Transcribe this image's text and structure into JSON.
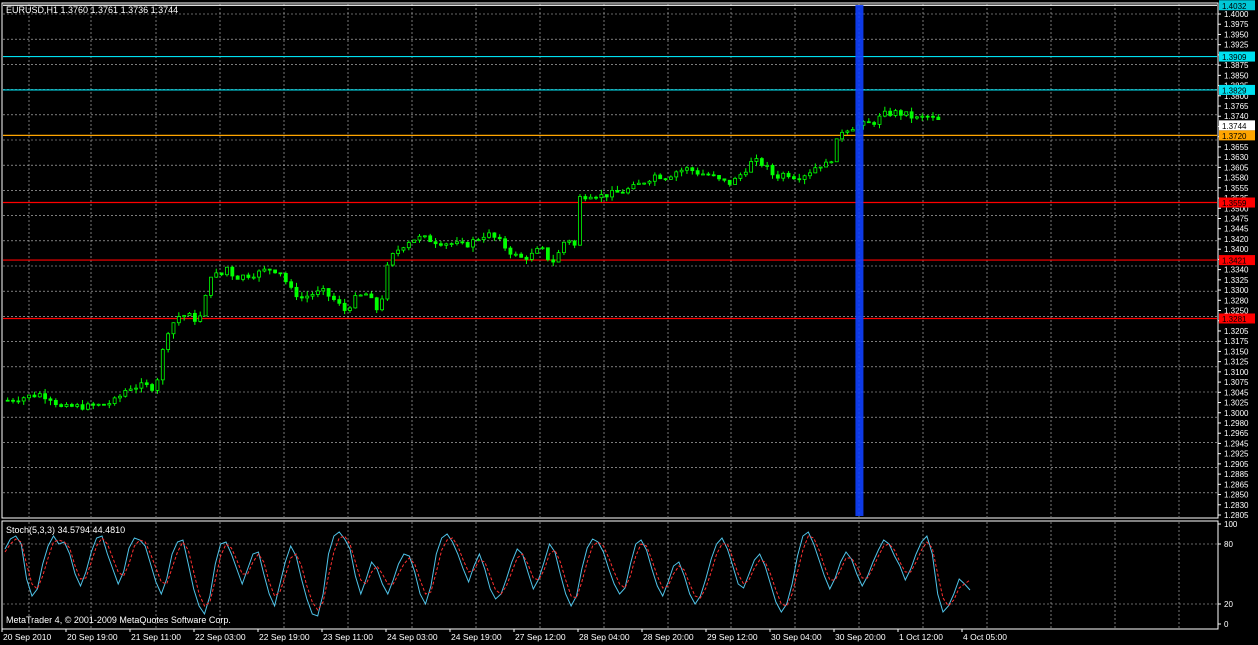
{
  "window": {
    "symbol_info": "EURUSD,H1  1.3760 1.3761 1.3736 1.3744",
    "indicator_info": "Stoch(5,3,3) 34.5794 44.4810",
    "copyright": "MetaTrader 4, © 2001-2009 MetaQuotes Software Corp."
  },
  "colors": {
    "background": "#000000",
    "grid": "#c8c8c8",
    "candle": "#00ff00",
    "axis_text": "#ffffff",
    "stoch_main": "#4fc3e8",
    "stoch_signal": "#ff3030",
    "vline": "#1040ff",
    "border": "#ffffff"
  },
  "chart_data": [
    {
      "type": "candlestick",
      "symbol": "EURUSD",
      "timeframe": "H1",
      "ylim": [
        1.2805,
        1.4035
      ],
      "price_ticks": [
        "1.4000",
        "1.3975",
        "1.3950",
        "1.3925",
        "1.3900",
        "1.3875",
        "1.3850",
        "1.3825",
        "1.3800",
        "1.3765",
        "1.3740",
        "1.3715",
        "1.3685",
        "1.3655",
        "1.3630",
        "1.3605",
        "1.3580",
        "1.3555",
        "1.3535",
        "1.3500",
        "1.3475",
        "1.3445",
        "1.3420",
        "1.3400",
        "1.3365",
        "1.3340",
        "1.3325",
        "1.3300",
        "1.3280",
        "1.3250",
        "1.3225",
        "1.3205",
        "1.3175",
        "1.3150",
        "1.3125",
        "1.3100",
        "1.3075",
        "1.3045",
        "1.3025",
        "1.3000",
        "1.2980",
        "1.2965",
        "1.2945",
        "1.2925",
        "1.2905",
        "1.2885",
        "1.2865",
        "1.2850",
        "1.2830",
        "1.2805"
      ],
      "time_labels": [
        "20 Sep 2010",
        "20 Sep 19:00",
        "21 Sep 11:00",
        "22 Sep 03:00",
        "22 Sep 19:00",
        "23 Sep 11:00",
        "24 Sep 03:00",
        "24 Sep 19:00",
        "27 Sep 12:00",
        "28 Sep 04:00",
        "28 Sep 20:00",
        "29 Sep 12:00",
        "30 Sep 04:00",
        "30 Sep 20:00",
        "1 Oct 12:00",
        "4 Oct 05:00"
      ],
      "horizontal_lines": [
        {
          "price": 1.4032,
          "label": "1.4032",
          "color": "#ffffff",
          "tag_bg": "#00c8d8",
          "tag_fg": "#000000"
        },
        {
          "price": 1.3909,
          "label": "1.3909",
          "color": "#00e0f0",
          "tag_bg": "#00e0f0",
          "tag_fg": "#000000"
        },
        {
          "price": 1.3829,
          "label": "1.3829",
          "color": "#00e0f0",
          "tag_bg": "#00e0f0",
          "tag_fg": "#000000"
        },
        {
          "price": 1.3744,
          "label": "1.3744",
          "color": null,
          "tag_bg": "#ffffff",
          "tag_fg": "#000000"
        },
        {
          "price": 1.372,
          "label": "1.3720",
          "color": "#ffa500",
          "tag_bg": "#ffa500",
          "tag_fg": "#000000"
        },
        {
          "price": 1.3559,
          "label": "1.3559",
          "color": "#ff0000",
          "tag_bg": "#ff0000",
          "tag_fg": "#000000"
        },
        {
          "price": 1.3421,
          "label": "1.3421",
          "color": "#ff0000",
          "tag_bg": "#ff0000",
          "tag_fg": "#000000"
        },
        {
          "price": 1.3281,
          "label": "1.3281",
          "color": "#ff0000",
          "tag_bg": "#ff0000",
          "tag_fg": "#000000"
        }
      ],
      "vertical_marker_bar": 159,
      "bar_count": 175,
      "close_path": [
        [
          0,
          1.3085
        ],
        [
          8,
          1.3095
        ],
        [
          12,
          1.31
        ],
        [
          16,
          1.309
        ],
        [
          20,
          1.3065
        ],
        [
          24,
          1.307
        ],
        [
          30,
          1.307
        ],
        [
          36,
          1.3075
        ],
        [
          40,
          1.3085
        ],
        [
          44,
          1.3115
        ],
        [
          50,
          1.312
        ],
        [
          54,
          1.3115
        ],
        [
          56,
          1.316
        ],
        [
          58,
          1.3245
        ],
        [
          60,
          1.326
        ],
        [
          62,
          1.3285
        ],
        [
          66,
          1.329
        ],
        [
          70,
          1.3275
        ],
        [
          72,
          1.33
        ],
        [
          74,
          1.3385
        ],
        [
          76,
          1.339
        ],
        [
          78,
          1.3375
        ],
        [
          80,
          1.341
        ],
        [
          82,
          1.339
        ],
        [
          84,
          1.338
        ],
        [
          88,
          1.3385
        ],
        [
          92,
          1.339
        ],
        [
          96,
          1.34
        ],
        [
          100,
          1.3395
        ],
        [
          104,
          1.335
        ],
        [
          108,
          1.333
        ],
        [
          112,
          1.334
        ],
        [
          116,
          1.3345
        ],
        [
          120,
          1.3325
        ],
        [
          124,
          1.33
        ],
        [
          128,
          1.333
        ],
        [
          132,
          1.334
        ],
        [
          136,
          1.33
        ],
        [
          138,
          1.334
        ],
        [
          140,
          1.342
        ],
        [
          144,
          1.345
        ],
        [
          148,
          1.347
        ],
        [
          152,
          1.3475
        ],
        [
          158,
          1.3465
        ],
        [
          164,
          1.346
        ],
        [
          168,
          1.3455
        ],
        [
          172,
          1.347
        ],
        [
          176,
          1.3485
        ],
        [
          180,
          1.347
        ],
        [
          184,
          1.3445
        ],
        [
          188,
          1.3425
        ],
        [
          192,
          1.343
        ],
        [
          196,
          1.345
        ],
        [
          198,
          1.343
        ],
        [
          200,
          1.3415
        ],
        [
          202,
          1.343
        ],
        [
          204,
          1.346
        ],
        [
          206,
          1.348
        ],
        [
          208,
          1.343
        ],
        [
          210,
          1.357
        ],
        [
          214,
          1.358
        ],
        [
          218,
          1.3575
        ],
        [
          222,
          1.358
        ],
        [
          226,
          1.3585
        ],
        [
          230,
          1.3595
        ],
        [
          234,
          1.361
        ],
        [
          238,
          1.3625
        ],
        [
          242,
          1.362
        ],
        [
          246,
          1.3635
        ],
        [
          250,
          1.364
        ],
        [
          254,
          1.363
        ],
        [
          258,
          1.3625
        ],
        [
          262,
          1.361
        ],
        [
          266,
          1.3605
        ],
        [
          270,
          1.363
        ],
        [
          274,
          1.366
        ],
        [
          278,
          1.365
        ],
        [
          282,
          1.362
        ],
        [
          286,
          1.363
        ],
        [
          290,
          1.362
        ],
        [
          294,
          1.363
        ],
        [
          298,
          1.365
        ],
        [
          302,
          1.365
        ],
        [
          306,
          1.373
        ],
        [
          310,
          1.374
        ],
        [
          314,
          1.3745
        ],
        [
          318,
          1.375
        ],
        [
          322,
          1.377
        ],
        [
          326,
          1.3775
        ],
        [
          330,
          1.377
        ],
        [
          334,
          1.376
        ],
        [
          338,
          1.3765
        ],
        [
          342,
          1.3755
        ],
        [
          344,
          1.3744
        ]
      ],
      "ohlc_note": "candles rendered from estimated close path"
    },
    {
      "type": "line",
      "indicator": "Stoch(5,3,3)",
      "ylim": [
        0,
        100
      ],
      "levels": [
        20,
        80
      ],
      "y_ticks": [
        "100",
        "80",
        "20",
        "0"
      ],
      "series": [
        {
          "role": "main",
          "values": [
            75,
            85,
            88,
            80,
            45,
            28,
            35,
            60,
            78,
            88,
            80,
            82,
            70,
            50,
            38,
            52,
            72,
            86,
            88,
            70,
            55,
            40,
            52,
            76,
            86,
            84,
            78,
            60,
            42,
            30,
            45,
            70,
            82,
            84,
            60,
            35,
            18,
            10,
            28,
            60,
            80,
            82,
            70,
            55,
            40,
            55,
            70,
            72,
            50,
            30,
            18,
            40,
            62,
            78,
            68,
            45,
            25,
            10,
            8,
            30,
            70,
            88,
            92,
            85,
            75,
            48,
            30,
            45,
            62,
            55,
            40,
            30,
            44,
            60,
            70,
            68,
            52,
            30,
            20,
            38,
            70,
            86,
            90,
            82,
            70,
            55,
            42,
            58,
            70,
            55,
            35,
            25,
            30,
            45,
            62,
            75,
            70,
            52,
            35,
            45,
            62,
            80,
            72,
            50,
            30,
            18,
            28,
            55,
            76,
            85,
            82,
            72,
            55,
            40,
            30,
            36,
            60,
            80,
            84,
            74,
            55,
            38,
            28,
            42,
            58,
            62,
            48,
            30,
            20,
            28,
            45,
            65,
            80,
            86,
            75,
            58,
            40,
            36,
            50,
            64,
            70,
            58,
            40,
            22,
            12,
            20,
            40,
            68,
            88,
            92,
            80,
            64,
            48,
            35,
            46,
            62,
            72,
            65,
            50,
            38,
            48,
            62,
            74,
            84,
            80,
            68,
            58,
            44,
            55,
            70,
            82,
            88,
            70,
            30,
            12,
            18,
            30,
            45,
            40,
            34
          ]
        },
        {
          "role": "signal",
          "values": [
            72,
            80,
            85,
            82,
            60,
            40,
            35,
            48,
            66,
            82,
            84,
            82,
            76,
            58,
            45,
            46,
            62,
            78,
            86,
            80,
            66,
            52,
            48,
            60,
            78,
            84,
            82,
            70,
            56,
            42,
            40,
            56,
            72,
            82,
            74,
            52,
            30,
            18,
            22,
            44,
            68,
            80,
            76,
            64,
            50,
            50,
            62,
            70,
            62,
            42,
            28,
            32,
            48,
            66,
            70,
            58,
            38,
            22,
            14,
            22,
            48,
            72,
            86,
            88,
            80,
            62,
            44,
            40,
            52,
            58,
            50,
            40,
            40,
            50,
            60,
            66,
            60,
            44,
            30,
            32,
            52,
            74,
            84,
            86,
            78,
            64,
            52,
            54,
            64,
            62,
            48,
            34,
            30,
            38,
            52,
            66,
            70,
            60,
            46,
            44,
            54,
            70,
            74,
            62,
            44,
            28,
            26,
            42,
            62,
            78,
            82,
            78,
            66,
            52,
            40,
            36,
            48,
            68,
            80,
            78,
            64,
            48,
            36,
            38,
            50,
            58,
            54,
            40,
            28,
            26,
            36,
            52,
            70,
            80,
            80,
            66,
            50,
            40,
            44,
            56,
            64,
            62,
            50,
            34,
            20,
            18,
            30,
            52,
            74,
            88,
            86,
            74,
            58,
            44,
            44,
            54,
            66,
            66,
            58,
            46,
            46,
            56,
            68,
            78,
            80,
            74,
            62,
            52,
            52,
            62,
            74,
            82,
            76,
            50,
            26,
            18,
            24,
            36,
            40,
            44
          ]
        }
      ]
    }
  ]
}
